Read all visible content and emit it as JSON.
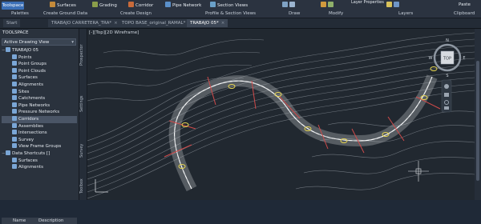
{
  "ribbon": {
    "workspace": "Toolspace",
    "buttons": {
      "surfaces": "Surfaces",
      "grading": "Grading",
      "corridor": "Corridor",
      "pipe_network": "Pipe Network",
      "section_views": "Section Views",
      "layer_properties": "Layer Properties",
      "paste": "Paste"
    },
    "panels": {
      "palettes": "Palettes",
      "create_ground_data": "Create Ground Data",
      "create_design": "Create Design",
      "profile_section_views": "Profile & Section Views",
      "draw": "Draw",
      "modify": "Modify",
      "layers": "Layers",
      "clipboard": "Clipboard"
    }
  },
  "tabs": [
    "Start",
    "TRABAJO CARRETERA_TRA*",
    "TOPO BASE_original_RAMAL*",
    "TRABAJO 05*"
  ],
  "toolspace": {
    "title": "TOOLSPACE",
    "view_label": "Active Drawing View",
    "tree": [
      {
        "label": "TRABAJO 05",
        "level": 0,
        "exp": "−"
      },
      {
        "label": "Points",
        "level": 1
      },
      {
        "label": "Point Groups",
        "level": 1
      },
      {
        "label": "Point Clouds",
        "level": 1
      },
      {
        "label": "Surfaces",
        "level": 1
      },
      {
        "label": "Alignments",
        "level": 1
      },
      {
        "label": "Sites",
        "level": 1
      },
      {
        "label": "Catchments",
        "level": 1
      },
      {
        "label": "Pipe Networks",
        "level": 1
      },
      {
        "label": "Pressure Networks",
        "level": 1
      },
      {
        "label": "Corridors",
        "level": 1,
        "selected": true
      },
      {
        "label": "Assemblies",
        "level": 1
      },
      {
        "label": "Intersections",
        "level": 1
      },
      {
        "label": "Survey",
        "level": 1
      },
      {
        "label": "View Frame Groups",
        "level": 1
      },
      {
        "label": "Data Shortcuts []",
        "level": 0,
        "exp": "−"
      },
      {
        "label": "Surfaces",
        "level": 1
      },
      {
        "label": "Alignments",
        "level": 1
      }
    ],
    "desc_headers": {
      "name": "Name",
      "description": "Description"
    }
  },
  "side_tabs": [
    "Prospector",
    "Settings",
    "Survey",
    "Toolbox"
  ],
  "viewport_label": "[-][Top][2D Wireframe]",
  "viewcube": {
    "top": "TOP",
    "n": "N",
    "s": "S",
    "e": "E",
    "w": "W"
  },
  "colors": {
    "accent": "#3b6fb6",
    "canvas": "#212830",
    "contour": "#6d747c",
    "road": "#b9bcc0",
    "section": "#d04a4a",
    "marker": "#e8d650"
  }
}
